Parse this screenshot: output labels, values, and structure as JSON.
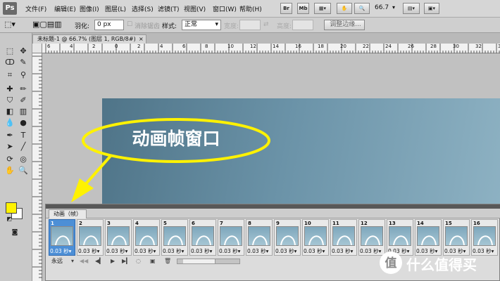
{
  "app": {
    "logo": "Ps"
  },
  "menu": [
    "文件(F)",
    "编辑(E)",
    "图像(I)",
    "图层(L)",
    "选择(S)",
    "滤镜(T)",
    "视图(V)",
    "窗口(W)",
    "帮助(H)"
  ],
  "app_toolbar": {
    "bridge_label": "Br",
    "minibridge_label": "Mb",
    "zoom": "66.7"
  },
  "options": {
    "feather_label": "羽化:",
    "feather_value": "0 px",
    "antialias_label": "消除锯齿",
    "style_label": "样式:",
    "style_value": "正常",
    "width_label": "宽度:",
    "height_label": "高度:",
    "refine_edge_label": "调整边缘..."
  },
  "document": {
    "tab_title": "未标题-1 @ 66.7% (图层 1, RGB/8#)"
  },
  "rulers": {
    "h_ticks": [
      "6",
      "4",
      "2",
      "0",
      "2",
      "4",
      "6",
      "8",
      "10",
      "12",
      "14",
      "16",
      "18",
      "20",
      "22",
      "24",
      "26",
      "28",
      "30",
      "32",
      "34"
    ]
  },
  "callout": {
    "text": "动画帧窗口"
  },
  "animation_panel": {
    "tab_label": "动画（帧）",
    "frames": [
      {
        "number": "1",
        "delay": "0.03 秒"
      },
      {
        "number": "2",
        "delay": "0.03 秒"
      },
      {
        "number": "3",
        "delay": "0.03 秒"
      },
      {
        "number": "4",
        "delay": "0.03 秒"
      },
      {
        "number": "5",
        "delay": "0.03 秒"
      },
      {
        "number": "6",
        "delay": "0.03 秒"
      },
      {
        "number": "7",
        "delay": "0.03 秒"
      },
      {
        "number": "8",
        "delay": "0.03 秒"
      },
      {
        "number": "9",
        "delay": "0.03 秒"
      },
      {
        "number": "10",
        "delay": "0.03 秒"
      },
      {
        "number": "11",
        "delay": "0.03 秒"
      },
      {
        "number": "12",
        "delay": "0.03 秒"
      },
      {
        "number": "13",
        "delay": "0.03 秒"
      },
      {
        "number": "14",
        "delay": "0.03 秒"
      },
      {
        "number": "15",
        "delay": "0.03 秒"
      },
      {
        "number": "16",
        "delay": "0.03 秒"
      }
    ],
    "selected_frame": "1",
    "loop_option": "永远"
  },
  "watermark": {
    "text": "什么值得买"
  },
  "colors": {
    "foreground": "#fff200",
    "background": "#ffffff",
    "callout": "#fff200",
    "frame_selected": "#4d8fd6"
  }
}
